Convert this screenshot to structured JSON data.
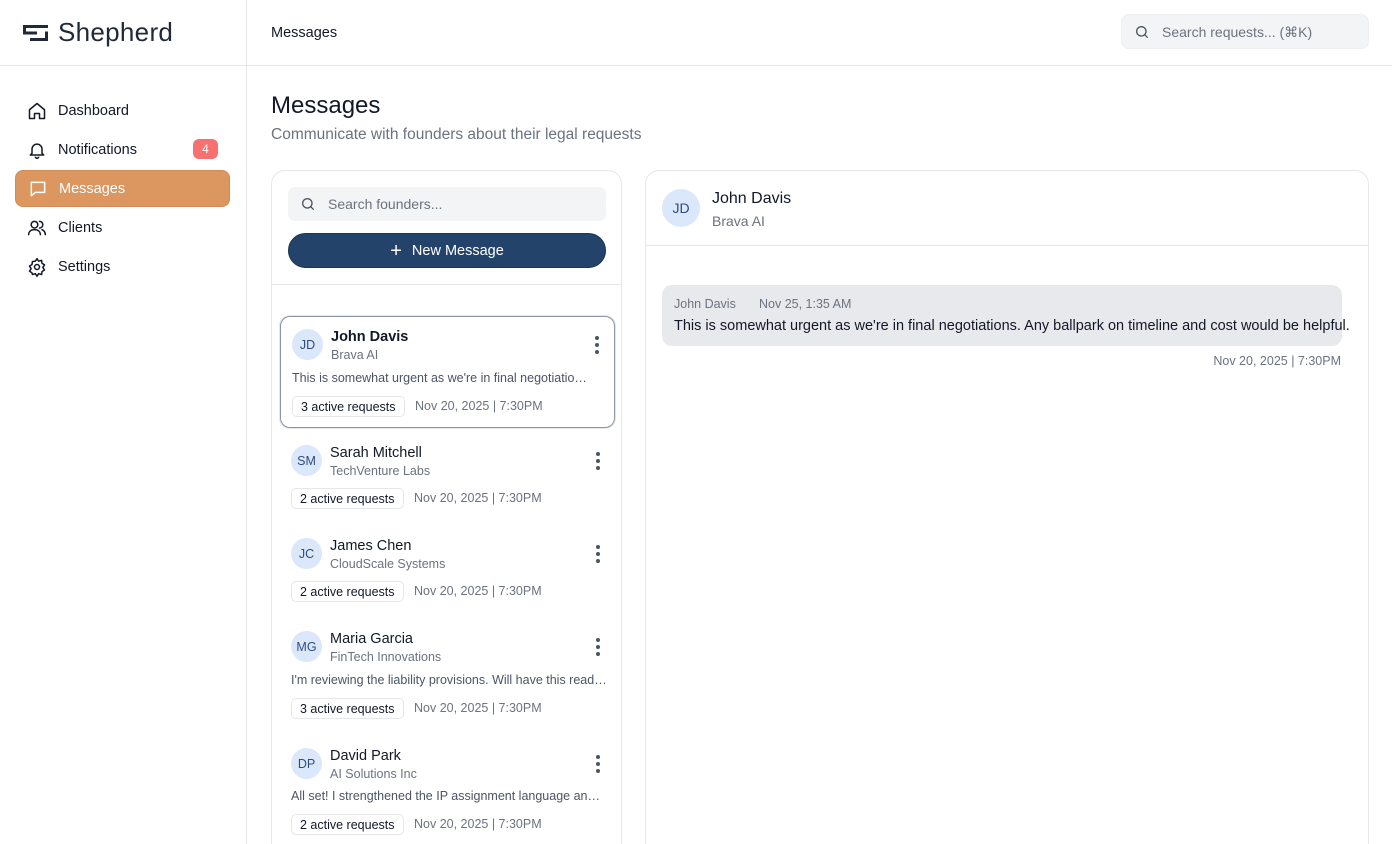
{
  "brand": {
    "name": "Shepherd"
  },
  "sidebar": {
    "items": [
      {
        "label": "Dashboard",
        "icon": "home-icon"
      },
      {
        "label": "Notifications",
        "icon": "bell-icon",
        "badge": "4"
      },
      {
        "label": "Messages",
        "icon": "message-icon",
        "active": true
      },
      {
        "label": "Clients",
        "icon": "users-icon"
      },
      {
        "label": "Settings",
        "icon": "gear-icon"
      }
    ]
  },
  "topbar": {
    "title": "Messages",
    "search_placeholder": "Search requests... (⌘K)"
  },
  "page": {
    "title": "Messages",
    "subtitle": "Communicate with founders about their legal requests"
  },
  "founders": {
    "search_placeholder": "Search founders...",
    "new_message_label": "New Message",
    "conversations": [
      {
        "initials": "JD",
        "name": "John Davis",
        "company": "Brava AI",
        "preview": "This is somewhat urgent as we're in final negotiations. Any ballpark on timeline and cost would be helpful.",
        "requests": "3 active requests",
        "date": "Nov 20, 2025 | 7:30PM",
        "selected": true
      },
      {
        "initials": "SM",
        "name": "Sarah Mitchell",
        "company": "TechVenture Labs",
        "preview": "",
        "requests": "2 active requests",
        "date": "Nov 20, 2025 | 7:30PM"
      },
      {
        "initials": "JC",
        "name": "James Chen",
        "company": "CloudScale Systems",
        "preview": "",
        "requests": "2 active requests",
        "date": "Nov 20, 2025 | 7:30PM"
      },
      {
        "initials": "MG",
        "name": "Maria Garcia",
        "company": "FinTech Innovations",
        "preview": "I'm reviewing the liability provisions. Will have this ready by end of day.",
        "requests": "3 active requests",
        "date": "Nov 20, 2025 | 7:30PM"
      },
      {
        "initials": "DP",
        "name": "David Park",
        "company": "AI Solutions Inc",
        "preview": "All set! I strengthened the IP assignment language and added the clause you asked about.",
        "requests": "2 active requests",
        "date": "Nov 20, 2025 | 7:30PM"
      }
    ]
  },
  "chat": {
    "initials": "JD",
    "name": "John Davis",
    "company": "Brava AI",
    "messages": [
      {
        "sender": "John Davis",
        "time": "Nov 25, 1:35 AM",
        "text": "This is somewhat urgent as we're in final negotiations. Any ballpark on timeline and cost would be helpful.",
        "footer": "Nov 20, 2025 | 7:30PM"
      }
    ]
  },
  "colors": {
    "accent": "#dc965f",
    "primary": "#23436b",
    "badge": "#f87171",
    "avatar_bg": "#dbe7fb"
  }
}
